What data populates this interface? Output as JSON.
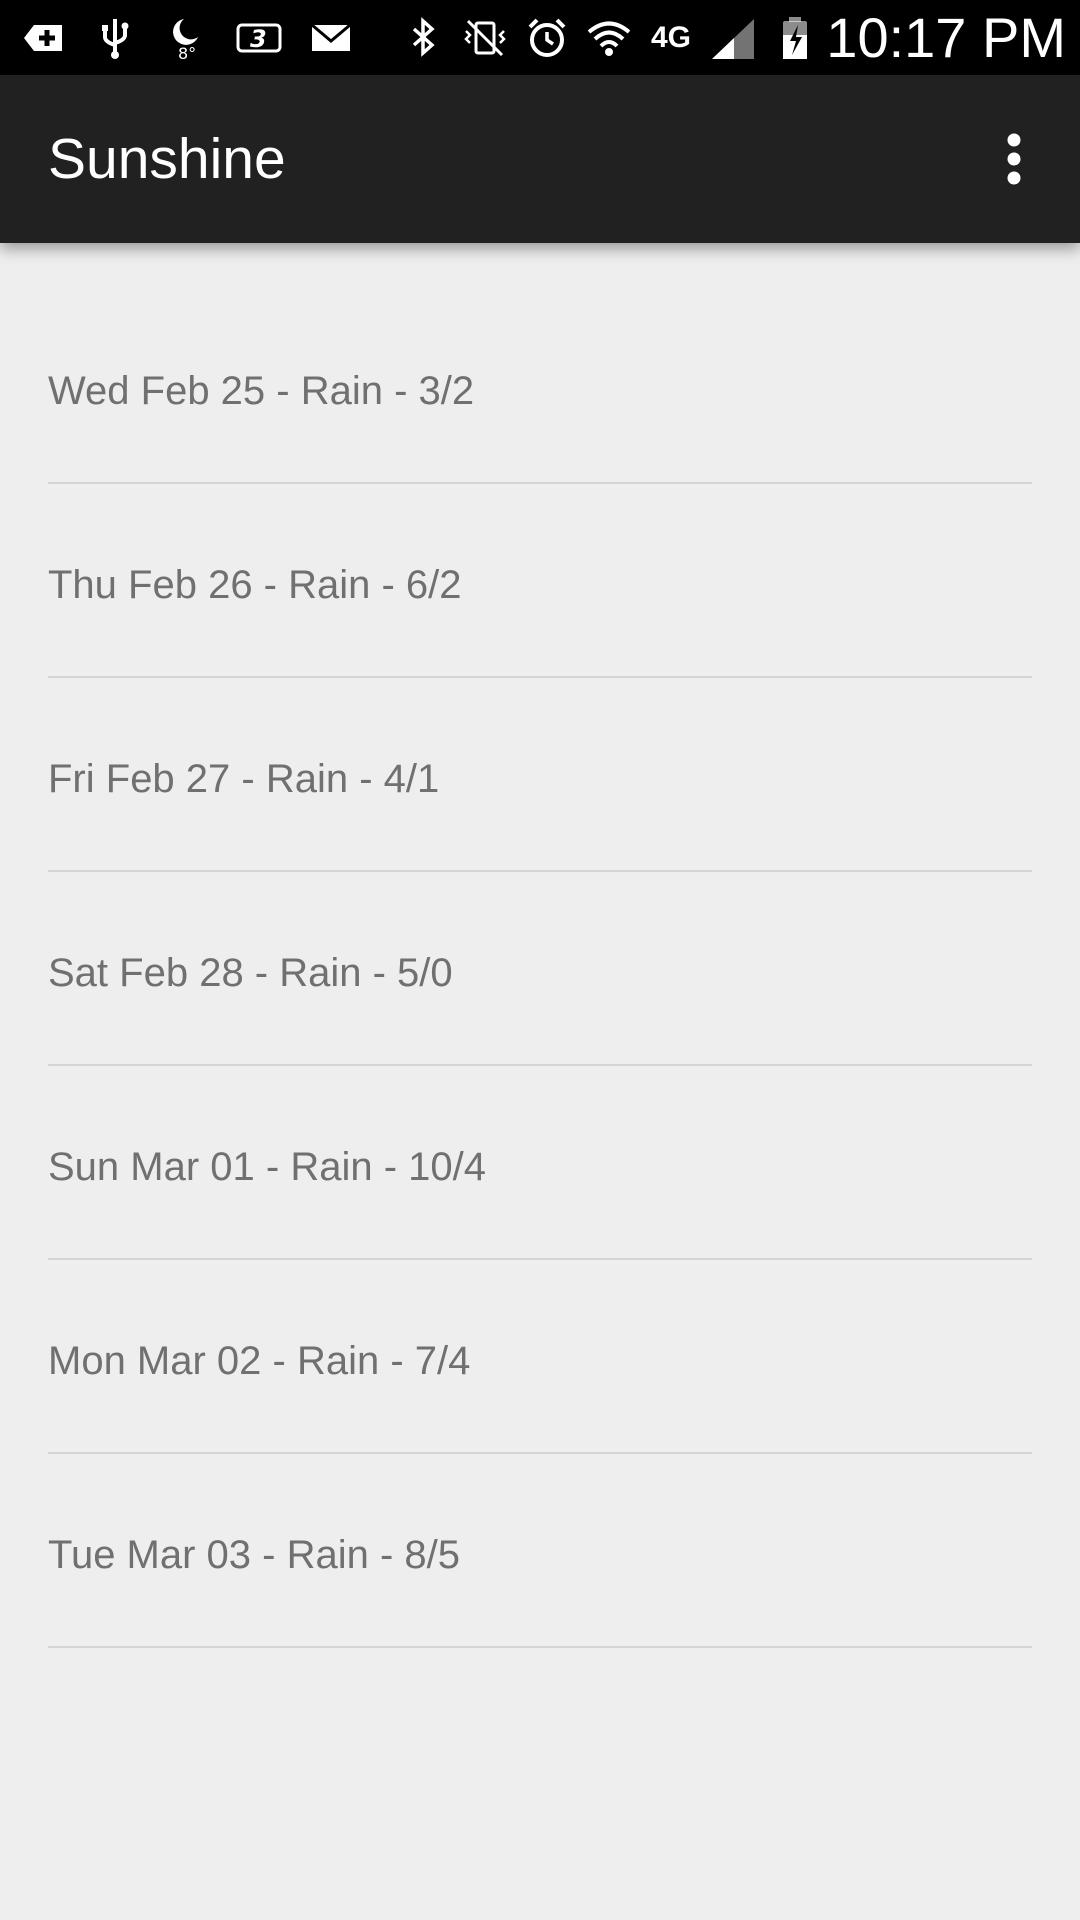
{
  "status_bar": {
    "time": "10:17 PM",
    "network_label": "4G",
    "icons": [
      "add-notification-icon",
      "usb-icon",
      "weather-moon-icon",
      "carrier-3-icon",
      "gmail-icon",
      "bluetooth-icon",
      "vibrate-icon",
      "alarm-icon",
      "wifi-icon",
      "lte-4g-icon",
      "signal-icon",
      "battery-charging-icon"
    ]
  },
  "app_bar": {
    "title": "Sunshine",
    "overflow_icon": "more-vert-icon"
  },
  "forecast": {
    "items": [
      {
        "label": "Wed Feb 25 - Rain - 3/2"
      },
      {
        "label": "Thu Feb 26 - Rain - 6/2"
      },
      {
        "label": "Fri Feb 27 - Rain - 4/1"
      },
      {
        "label": "Sat Feb 28 - Rain - 5/0"
      },
      {
        "label": "Sun Mar 01 - Rain - 10/4"
      },
      {
        "label": "Mon Mar 02 - Rain - 7/4"
      },
      {
        "label": "Tue Mar 03 - Rain - 8/5"
      }
    ]
  },
  "colors": {
    "status_bar": "#000000",
    "app_bar": "#212121",
    "background": "#eeeeee",
    "item_text": "#707070",
    "divider": "#d4d4d4"
  }
}
